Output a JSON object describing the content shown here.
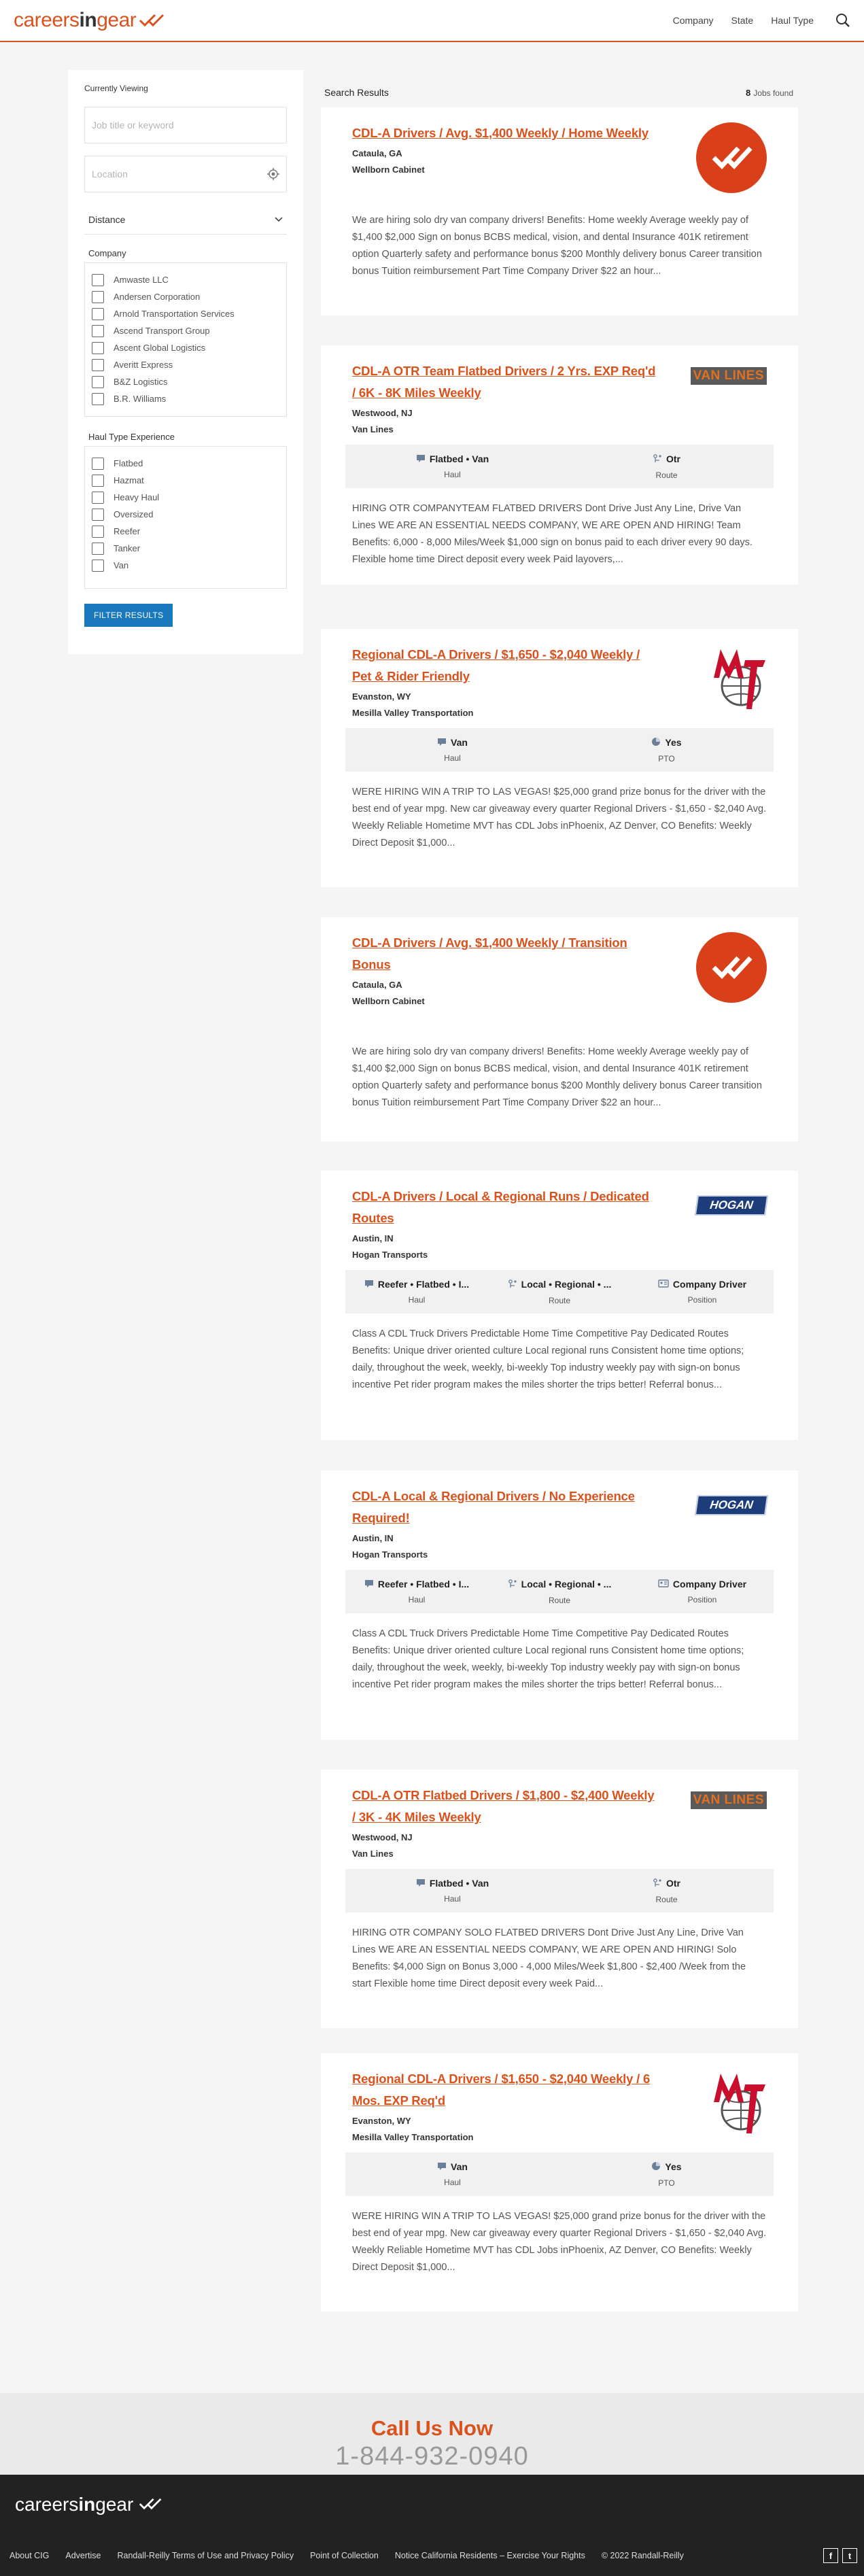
{
  "header": {
    "logo_prefix": "careers",
    "logo_bold": "in",
    "logo_suffix": "gear",
    "nav": [
      "Company",
      "State",
      "Haul Type"
    ]
  },
  "sidebar": {
    "title": "Currently Viewing",
    "keyword_placeholder": "Job title or keyword",
    "location_placeholder": "Location",
    "distance_label": "Distance",
    "company_label": "Company",
    "companies": [
      "Amwaste LLC",
      "Andersen Corporation",
      "Arnold Transportation Services",
      "Ascend Transport Group",
      "Ascent Global Logistics",
      "Averitt Express",
      "B&Z Logistics",
      "B.R. Williams"
    ],
    "haul_label": "Haul Type Experience",
    "haul_types": [
      "Flatbed",
      "Hazmat",
      "Heavy Haul",
      "Oversized",
      "Reefer",
      "Tanker",
      "Van"
    ],
    "filter_button": "FILTER RESULTS"
  },
  "results": {
    "title": "Search Results",
    "count": "8",
    "count_label": "Jobs found"
  },
  "jobs": [
    {
      "title": "CDL-A Drivers / Avg. $1,400 Weekly / Home Weekly",
      "location": "Cataula, GA",
      "company": "Wellborn Cabinet",
      "logo": "wellborn",
      "attrs": [],
      "desc": "We are hiring solo dry van company drivers! Benefits: Home weekly Average weekly pay of $1,400 $2,000 Sign on bonus BCBS medical, vision, and dental Insurance 401K retirement option Quarterly safety and performance bonus $200 Monthly delivery bonus Career transition bonus Tuition reimbursement Part Time Company Driver $22 an hour..."
    },
    {
      "title": "CDL-A OTR Team Flatbed Drivers / 2 Yrs. EXP Req'd / 6K - 8K Miles Weekly",
      "location": "Westwood, NJ",
      "company": "Van Lines",
      "logo": "vanlines",
      "attrs": [
        {
          "v": "Flatbed • Van",
          "l": "Haul",
          "icon": "truck"
        },
        {
          "v": "Otr",
          "l": "Route",
          "icon": "route"
        }
      ],
      "desc": "HIRING OTR COMPANYTEAM FLATBED DRIVERS Dont Drive Just Any Line, Drive Van Lines WE ARE AN ESSENTIAL NEEDS COMPANY, WE ARE OPEN AND HIRING! Team Benefits: 6,000 - 8,000 Miles/Week $1,000 sign on bonus paid to each driver every 90 days. Flexible home time Direct deposit every week Paid layovers,..."
    },
    {
      "title": "Regional CDL-A Drivers / $1,650 - $2,040 Weekly / Pet & Rider Friendly",
      "location": "Evanston, WY",
      "company": "Mesilla Valley Transportation",
      "logo": "mvt",
      "attrs": [
        {
          "v": "Van",
          "l": "Haul",
          "icon": "truck"
        },
        {
          "v": "Yes",
          "l": "PTO",
          "icon": "pto"
        }
      ],
      "desc": "WERE HIRING WIN A TRIP TO LAS VEGAS! $25,000 grand prize bonus for the driver with the best end of year mpg. New car giveaway every quarter Regional Drivers - $1,650 - $2,040 Avg. Weekly Reliable Hometime MVT has CDL Jobs inPhoenix, AZ Denver, CO Benefits: Weekly Direct Deposit $1,000..."
    },
    {
      "title": "CDL-A Drivers / Avg. $1,400 Weekly / Transition Bonus",
      "location": "Cataula, GA",
      "company": "Wellborn Cabinet",
      "logo": "wellborn",
      "attrs": [],
      "desc": "We are hiring solo dry van company drivers! Benefits: Home weekly Average weekly pay of $1,400 $2,000 Sign on bonus BCBS medical, vision, and dental Insurance 401K retirement option Quarterly safety and performance bonus $200 Monthly delivery bonus Career transition bonus Tuition reimbursement Part Time Company Driver $22 an hour..."
    },
    {
      "title": "CDL-A Drivers / Local & Regional Runs / Dedicated Routes",
      "location": "Austin, IN",
      "company": "Hogan Transports",
      "logo": "hogan",
      "attrs": [
        {
          "v": "Reefer • Flatbed • I...",
          "l": "Haul",
          "icon": "truck"
        },
        {
          "v": "Local • Regional • ...",
          "l": "Route",
          "icon": "route"
        },
        {
          "v": "Company Driver",
          "l": "Position",
          "icon": "id"
        }
      ],
      "desc": "Class A CDL Truck Drivers Predictable Home Time Competitive Pay Dedicated Routes Benefits: Unique driver oriented culture Local regional runs Consistent home time options; daily, throughout the week, weekly, bi-weekly Top industry weekly pay with sign-on bonus incentive Pet rider program makes the miles shorter the trips better! Referral bonus..."
    },
    {
      "title": "CDL-A Local & Regional Drivers / No Experience Required!",
      "location": "Austin, IN",
      "company": "Hogan Transports",
      "logo": "hogan",
      "attrs": [
        {
          "v": "Reefer • Flatbed • I...",
          "l": "Haul",
          "icon": "truck"
        },
        {
          "v": "Local • Regional • ...",
          "l": "Route",
          "icon": "route"
        },
        {
          "v": "Company Driver",
          "l": "Position",
          "icon": "id"
        }
      ],
      "desc": "Class A CDL Truck Drivers Predictable Home Time Competitive Pay Dedicated Routes Benefits: Unique driver oriented culture Local regional runs Consistent home time options; daily, throughout the week, weekly, bi-weekly Top industry weekly pay with sign-on bonus incentive Pet rider program makes the miles shorter the trips better! Referral bonus..."
    },
    {
      "title": "CDL-A OTR Flatbed Drivers / $1,800 - $2,400 Weekly / 3K - 4K Miles Weekly",
      "location": "Westwood, NJ",
      "company": "Van Lines",
      "logo": "vanlines",
      "attrs": [
        {
          "v": "Flatbed • Van",
          "l": "Haul",
          "icon": "truck"
        },
        {
          "v": "Otr",
          "l": "Route",
          "icon": "route"
        }
      ],
      "desc": "HIRING OTR COMPANY SOLO FLATBED DRIVERS Dont Drive Just Any Line, Drive Van Lines WE ARE AN ESSENTIAL NEEDS COMPANY, WE ARE OPEN AND HIRING! Solo Benefits: $4,000 Sign on Bonus 3,000 - 4,000 Miles/Week $1,800 - $2,400 /Week from the start Flexible home time Direct deposit every week Paid..."
    },
    {
      "title": "Regional CDL-A Drivers / $1,650 - $2,040 Weekly / 6 Mos. EXP Req'd",
      "location": "Evanston, WY",
      "company": "Mesilla Valley Transportation",
      "logo": "mvt",
      "attrs": [
        {
          "v": "Van",
          "l": "Haul",
          "icon": "truck"
        },
        {
          "v": "Yes",
          "l": "PTO",
          "icon": "pto"
        }
      ],
      "desc": "WERE HIRING WIN A TRIP TO LAS VEGAS! $25,000 grand prize bonus for the driver with the best end of year mpg. New car giveaway every quarter Regional Drivers - $1,650 - $2,040 Avg. Weekly Reliable Hometime MVT has CDL Jobs inPhoenix, AZ Denver, CO Benefits: Weekly Direct Deposit $1,000..."
    }
  ],
  "logos": {
    "vanlines": "VAN LINES",
    "hogan": "HOGAN",
    "mvt": "MVT"
  },
  "footer": {
    "call_label": "Call Us Now",
    "phone": "1-844-932-0940",
    "links": [
      "About CIG",
      "Advertise",
      "Randall-Reilly Terms of Use and Privacy Policy",
      "Point of Collection",
      "Notice California Residents – Exercise Your Rights",
      "© 2022 Randall-Reilly"
    ],
    "social": [
      "f",
      "t"
    ]
  },
  "colors": {
    "accent": "#d9531e",
    "button": "#1a79bd"
  }
}
